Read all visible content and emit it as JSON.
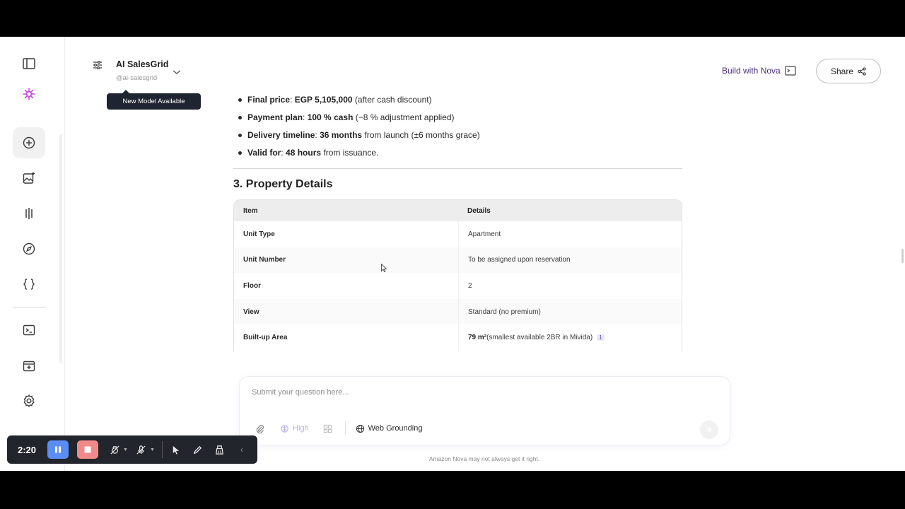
{
  "header": {
    "model_name": "AI SalesGrid",
    "model_handle": "@ai-salesgrid",
    "tooltip": "New Model Available",
    "build_link": "Build with Nova",
    "share_label": "Share"
  },
  "bullets": [
    {
      "label": "Final price",
      "sep": ": ",
      "value": "EGP 5,105,000",
      "rest": " (after cash discount)"
    },
    {
      "label": "Payment plan",
      "sep": ": ",
      "value": "100 % cash",
      "rest": " (−8 % adjustment applied)"
    },
    {
      "label": "Delivery timeline",
      "sep": ": ",
      "value": "36 months",
      "rest": " from launch (±6 months grace)"
    },
    {
      "label": "Valid for",
      "sep": ": ",
      "value": "48 hours",
      "rest": " from issuance."
    }
  ],
  "section_title": "3. Property Details",
  "table": {
    "headers": [
      "Item",
      "Details"
    ],
    "rows": [
      {
        "item": "Unit Type",
        "detail": "Apartment"
      },
      {
        "item": "Unit Number",
        "detail": "To be assigned upon reservation"
      },
      {
        "item": "Floor",
        "detail": "2"
      },
      {
        "item": "View",
        "detail": "Standard (no premium)"
      },
      {
        "item": "Built-up Area",
        "detail_bold": "79 m²",
        "detail": " (smallest available 2BR in Mivida)",
        "citation": "1"
      }
    ]
  },
  "input": {
    "placeholder": "Submit your question here...",
    "reasoning_level": "High",
    "web_grounding": "Web Grounding"
  },
  "disclaimer": "Amazon Nova may not always get it right.",
  "recorder": {
    "time": "2:20"
  },
  "colors": {
    "accent": "#4a2f7c",
    "nova_logo": "#c23fd6",
    "pause": "#5a8ef5",
    "stop": "#f08a8a"
  }
}
